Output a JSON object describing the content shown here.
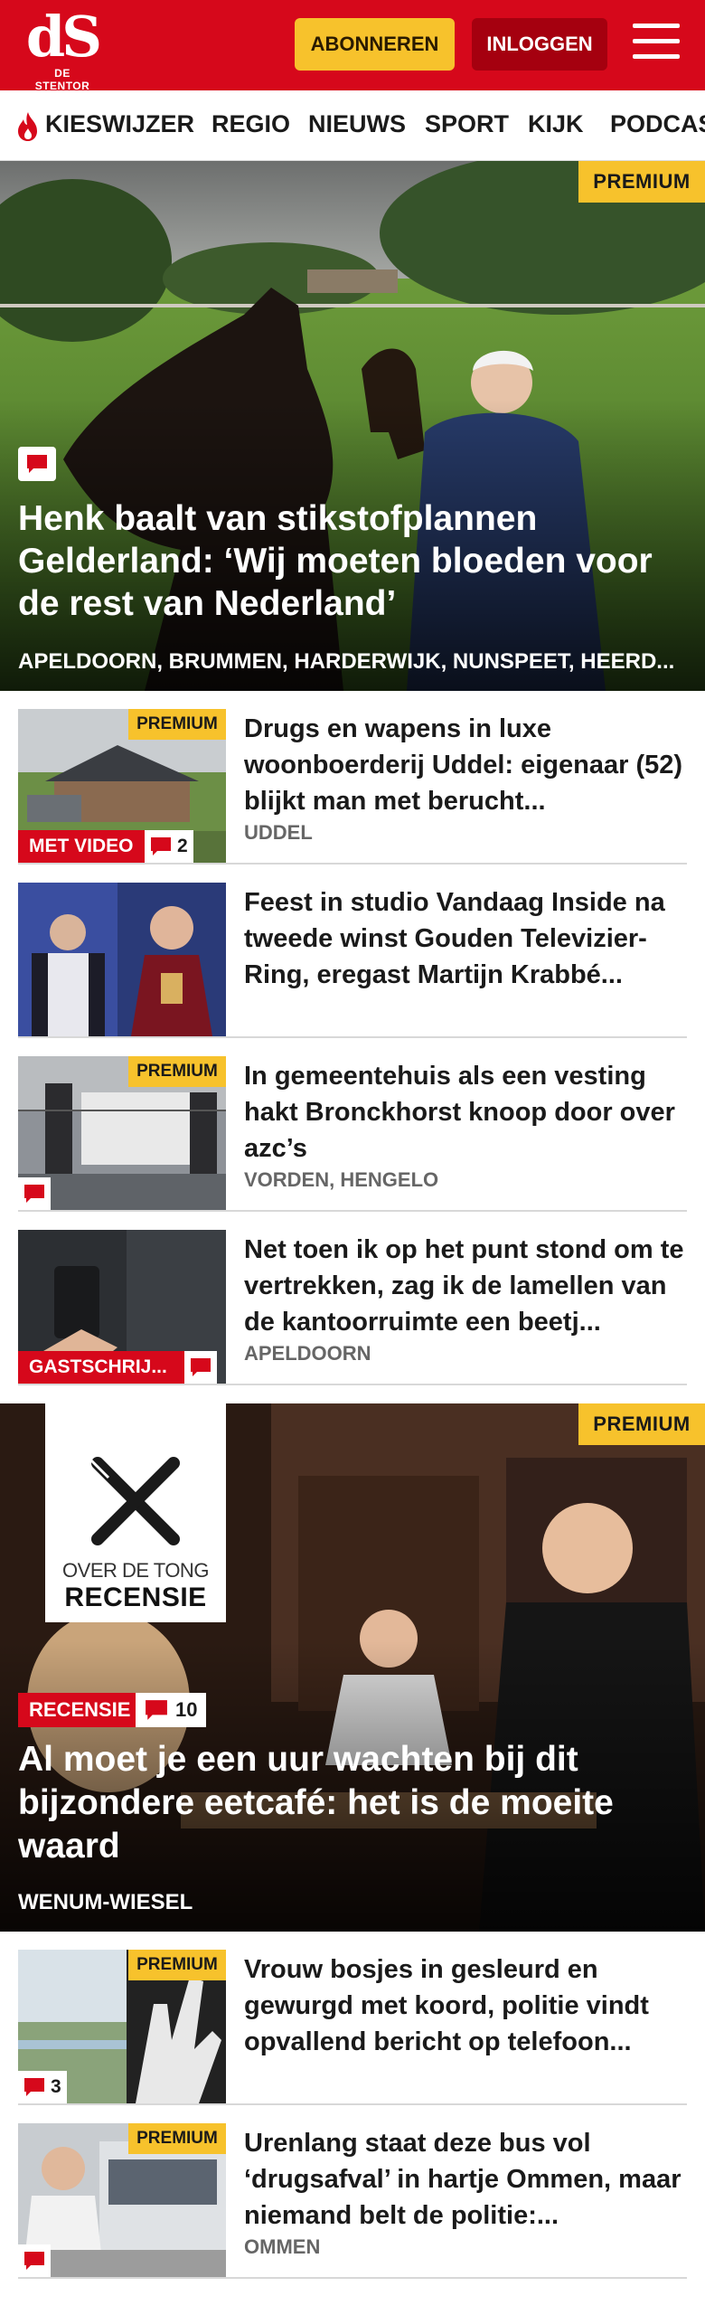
{
  "header": {
    "logo_mark": "dS",
    "logo_sub": "DE STENTOR",
    "subscribe_label": "ABONNEREN",
    "login_label": "INLOGGEN",
    "menu_icon": "hamburger-menu-icon",
    "brand_color": "#d6081b",
    "accent_color": "#f7c22c"
  },
  "nav": {
    "items": [
      {
        "label": "KIESWIJZER",
        "icon": "flame-icon"
      },
      {
        "label": "REGIO"
      },
      {
        "label": "NIEUWS"
      },
      {
        "label": "SPORT"
      },
      {
        "label": "KIJK"
      },
      {
        "label": "PODCAS"
      }
    ]
  },
  "hero": {
    "badge": "PREMIUM",
    "comment_icon": "comment-icon",
    "title": "Henk baalt van stikstofplannen Gelderland: ‘Wij moeten bloeden voor de rest van Nederland’",
    "location": "APELDOORN, BRUMMEN, HARDERWIJK, NUNSPEET, HEERD..."
  },
  "articles": [
    {
      "badge": "PREMIUM",
      "tag": "MET VIDEO",
      "comment_count": "2",
      "title": "Drugs en wapens in luxe woonboerderij Uddel: eigenaar (52) blijkt man met berucht...",
      "location": "UDDEL"
    },
    {
      "badge": "",
      "tag": "",
      "comment_count": "",
      "title": "Feest in studio Vandaag Inside na tweede winst Gouden Televizier-Ring, eregast Martijn Krabbé...",
      "location": ""
    },
    {
      "badge": "PREMIUM",
      "tag": "",
      "comment_count": "",
      "title": "In gemeentehuis als een vesting hakt Bronckhorst knoop door over azc’s",
      "location": "VORDEN, HENGELO"
    },
    {
      "badge": "",
      "tag": "GASTSCHRIJ...",
      "comment_count": "",
      "title": "Net toen ik op het punt stond om te vertrekken, zag ik de lamellen van de kantoorruimte een beetj...",
      "location": "APELDOORN"
    }
  ],
  "featured": {
    "badge": "PREMIUM",
    "logo_line1": "OVER DE TONG",
    "logo_line2": "RECENSIE",
    "logo_icon": "fork-knife-icon",
    "tag": "RECENSIE",
    "comment_count": "10",
    "title": "Al moet je een uur wachten bij dit bijzondere eetcafé: het is de moeite waard",
    "location": "WENUM-WIESEL"
  },
  "articles2": [
    {
      "badge": "PREMIUM",
      "comment_count": "3",
      "title": "Vrouw bosjes in gesleurd en gewurgd met koord, politie vindt opvallend bericht op telefoon...",
      "location": ""
    },
    {
      "badge": "PREMIUM",
      "comment_count": "",
      "title": "Urenlang staat deze bus vol ‘drugsafval’ in hartje Ommen, maar niemand belt de politie:...",
      "location": "OMMEN"
    }
  ]
}
